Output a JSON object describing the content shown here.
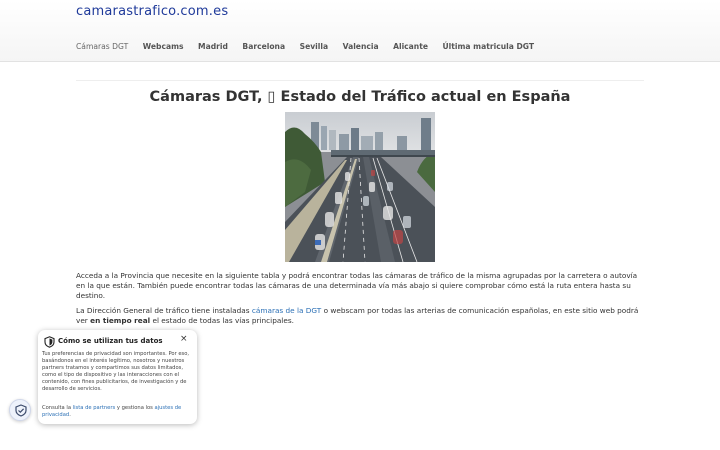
{
  "site": {
    "logo": "camarastrafico.com.es"
  },
  "nav": [
    {
      "label": "Cámaras DGT",
      "active": true
    },
    {
      "label": "Webcams"
    },
    {
      "label": "Madrid"
    },
    {
      "label": "Barcelona"
    },
    {
      "label": "Sevilla"
    },
    {
      "label": "Valencia"
    },
    {
      "label": "Alicante"
    },
    {
      "label": "Última matricula DGT"
    }
  ],
  "main": {
    "title": "Cámaras DGT, ▯ Estado del Tráfico actual en España",
    "image_icon": "highway-traffic-photo",
    "p1": "Acceda a la Provincia que necesite en la siguiente tabla y podrá encontrar todas las cámaras de tráfico de la misma agrupadas por la carretera o autovía en la que están. También puede encontrar todas las cámaras de una determinada vía más abajo si quiere comprobar cómo está la ruta entera hasta su destino.",
    "p2_before": "La Dirección General de tráfico tiene instaladas",
    "p2_link": "cámaras de la DGT",
    "p2_middle": "o webscam por todas las arterias de comunicación españolas, en este sitio web podrá ver",
    "p2_bold": "en tiempo real",
    "p2_after": "el estado de todas las vías principales."
  },
  "privacy": {
    "title": "Cómo se utilizan tus datos",
    "close": "×",
    "body": "Tus preferencias de privacidad son importantes. Por eso, basándonos en el interés legítimo, nosotros y nuestros partners tratamos y compartimos sus datos limitados, como el tipo de dispositivo y las interacciones con el contenido, con fines publicitarios, de investigación y de desarrollo de servicios.",
    "foot_before": "Consulta la",
    "foot_link1": "lista de partners",
    "foot_middle": "y gestiona los",
    "foot_link2": "ajustes de privacidad",
    "foot_after": "."
  },
  "colors": {
    "brand": "#1f3a9a",
    "link": "#2a6fb5"
  }
}
